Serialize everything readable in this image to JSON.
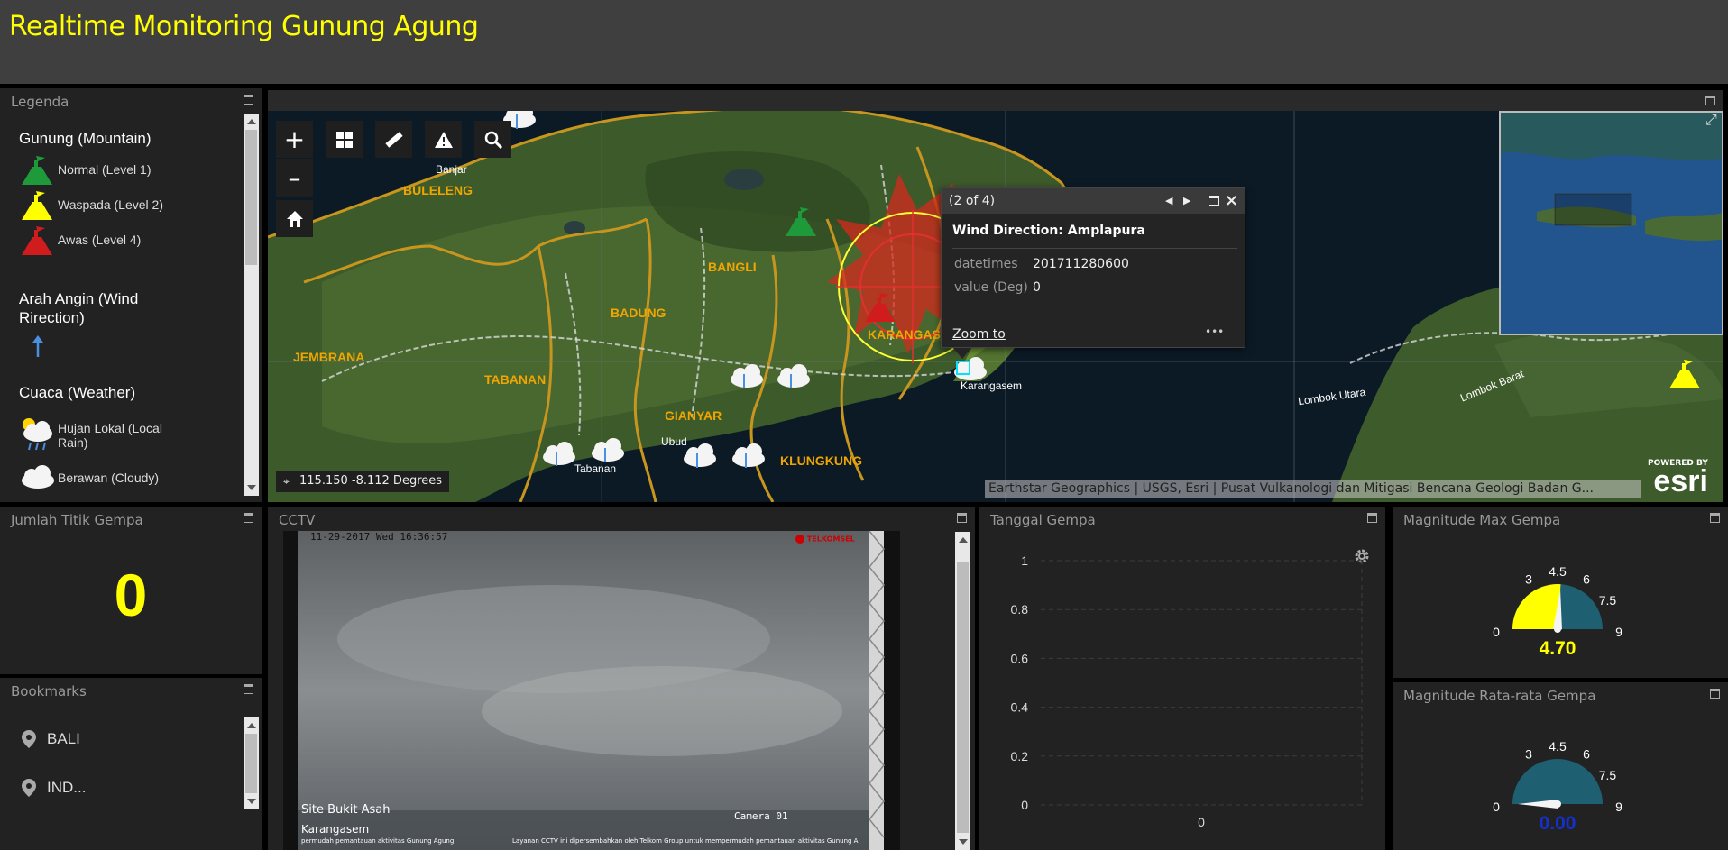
{
  "header": {
    "title": "Realtime Monitoring Gunung Agung"
  },
  "legend": {
    "title": "Legenda",
    "sections": [
      {
        "heading": "Gunung (Mountain)",
        "items": [
          "Normal (Level 1)",
          "Waspada (Level 2)",
          "Awas (Level 4)"
        ]
      },
      {
        "heading": "Arah Angin (Wind Rirection)"
      },
      {
        "heading": "Cuaca (Weather)",
        "items": [
          "Hujan Lokal (Local Rain)",
          "Berawan (Cloudy)"
        ]
      }
    ],
    "colors": {
      "normal": "#1f9a3a",
      "waspada": "#ffff00",
      "awas": "#d01c1c",
      "wind": "#4a90e2"
    }
  },
  "map": {
    "coordinates": "115.150 -8.112 Degrees",
    "attribution": "Earthstar Geographics | USGS, Esri | Pusat Vulkanologi dan Mitigasi Bencana Geologi Badan G...",
    "labels": [
      "Banjar",
      "BULELENG",
      "BANGLI",
      "BADUNG",
      "JEMBRANA",
      "TABANAN",
      "GIANYAR",
      "KLUNGKUNG",
      "KARANGAS",
      "Karangasem",
      "Ubud",
      "Tabanan",
      "Lombok Utara",
      "Lombok Barat"
    ],
    "esri": {
      "powered": "POWERED BY",
      "brand": "esri"
    },
    "tools": [
      "zoom-in",
      "basemap",
      "measure",
      "alert",
      "search",
      "zoom-out",
      "home"
    ],
    "popup": {
      "counter": "(2 of 4)",
      "title": "Wind Direction: Amplapura",
      "fields": [
        {
          "key": "datetimes",
          "value": "201711280600"
        },
        {
          "key": "value (Deg)",
          "value": "0"
        }
      ],
      "zoom_label": "Zoom to",
      "more": "•••"
    }
  },
  "earthquake_count": {
    "title": "Jumlah Titik Gempa",
    "value": "0"
  },
  "bookmarks": {
    "title": "Bookmarks",
    "items": [
      "BALI",
      "IND..."
    ]
  },
  "cctv": {
    "title": "CCTV",
    "timestamp": "11-29-2017 Wed 16:36:57",
    "brand": "TELKOMSEL",
    "site": "Site Bukit Asah",
    "location": "Karangasem",
    "camera": "Camera 01",
    "caption_left": "permudah pemantauan aktivitas Gunung Agung.",
    "caption_right": "Layanan CCTV ini dipersembahkan oleh Telkom Group untuk mempermudah pemantauan aktivitas Gunung A"
  },
  "date_chart": {
    "title": "Tanggal Gempa",
    "chart_data": {
      "type": "line",
      "x": [
        "0"
      ],
      "series": [],
      "yticks": [
        "1",
        "0.8",
        "0.6",
        "0.4",
        "0.2",
        "0"
      ],
      "ylim": [
        0,
        1
      ],
      "grid": true
    }
  },
  "gauge_max": {
    "title": "Magnitude Max Gempa",
    "ticks": [
      "0",
      "3",
      "4.5",
      "6",
      "7.5",
      "9"
    ],
    "value": 4.7,
    "value_label": "4.70",
    "range": [
      0,
      9
    ],
    "colors": {
      "fill": "#ffff00",
      "track": "#1f5f72",
      "value_text": "#ffff00"
    }
  },
  "gauge_avg": {
    "title": "Magnitude Rata-rata Gempa",
    "ticks": [
      "0",
      "3",
      "4.5",
      "6",
      "7.5",
      "9"
    ],
    "value": 0,
    "value_label": "0.00",
    "range": [
      0,
      9
    ],
    "colors": {
      "fill": "#ffff00",
      "track": "#1f5f72",
      "value_text": "#1530d0"
    }
  }
}
